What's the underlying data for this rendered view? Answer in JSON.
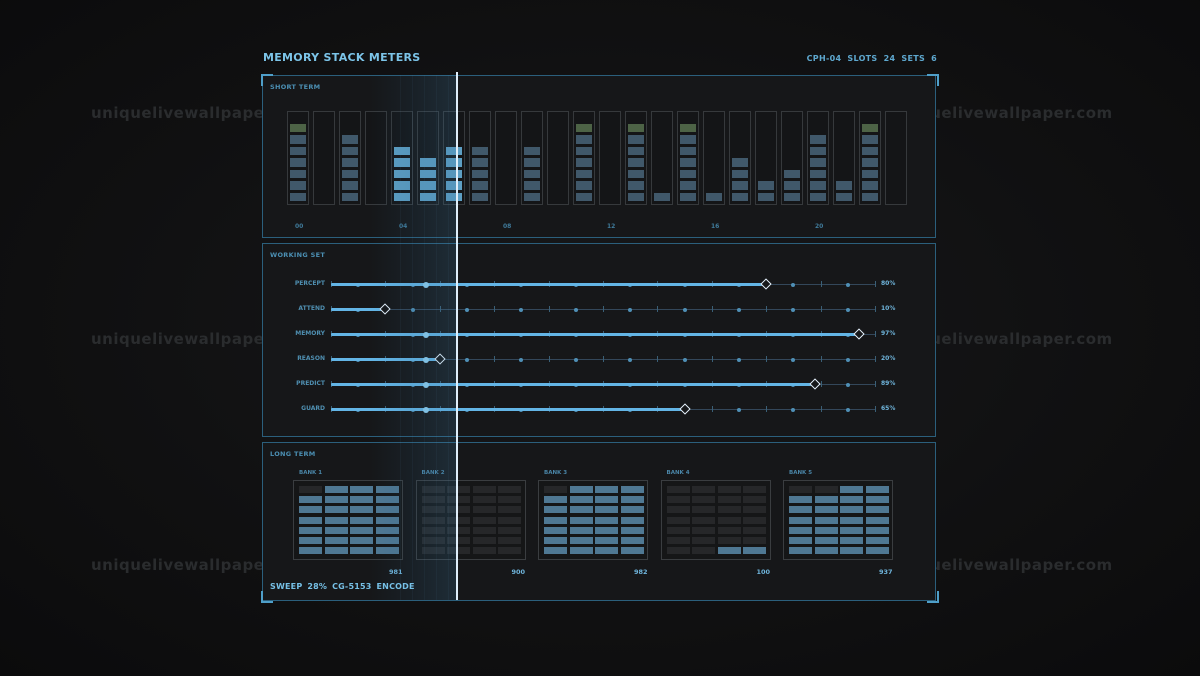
{
  "header": {
    "title": "MEMORY STACK METERS",
    "stats": "CPH-04  SLOTS 24  SETS 6"
  },
  "watermark": "uniquelivewallpaper.com",
  "short_term": {
    "label": "SHORT TERM",
    "axis_labels": [
      "00",
      "04",
      "08",
      "12",
      "16",
      "20"
    ],
    "meters": [
      {
        "level": 7,
        "warn": true,
        "active": false
      },
      {
        "level": 0,
        "warn": false,
        "active": false
      },
      {
        "level": 6,
        "warn": false,
        "active": false
      },
      {
        "level": 0,
        "warn": false,
        "active": false
      },
      {
        "level": 5,
        "warn": false,
        "active": true
      },
      {
        "level": 4,
        "warn": false,
        "active": true
      },
      {
        "level": 5,
        "warn": false,
        "active": true
      },
      {
        "level": 5,
        "warn": false,
        "active": false
      },
      {
        "level": 0,
        "warn": false,
        "active": false
      },
      {
        "level": 5,
        "warn": false,
        "active": false
      },
      {
        "level": 0,
        "warn": false,
        "active": false
      },
      {
        "level": 7,
        "warn": true,
        "active": false
      },
      {
        "level": 0,
        "warn": false,
        "active": false
      },
      {
        "level": 7,
        "warn": true,
        "active": false
      },
      {
        "level": 1,
        "warn": false,
        "active": false
      },
      {
        "level": 7,
        "warn": true,
        "active": false
      },
      {
        "level": 1,
        "warn": false,
        "active": false
      },
      {
        "level": 4,
        "warn": false,
        "active": false
      },
      {
        "level": 2,
        "warn": false,
        "active": false
      },
      {
        "level": 3,
        "warn": false,
        "active": false
      },
      {
        "level": 6,
        "warn": false,
        "active": false
      },
      {
        "level": 2,
        "warn": false,
        "active": false
      },
      {
        "level": 7,
        "warn": true,
        "active": false
      },
      {
        "level": 0,
        "warn": false,
        "active": false
      }
    ]
  },
  "working_set": {
    "label": "WORKING SET",
    "rows": [
      {
        "name": "PERCEPT",
        "value": 0.8,
        "value_label": "80%"
      },
      {
        "name": "ATTEND",
        "value": 0.1,
        "value_label": "10%"
      },
      {
        "name": "MEMORY",
        "value": 0.97,
        "value_label": "97%"
      },
      {
        "name": "REASON",
        "value": 0.2,
        "value_label": "20%"
      },
      {
        "name": "PREDICT",
        "value": 0.89,
        "value_label": "89%"
      },
      {
        "name": "GUARD",
        "value": 0.65,
        "value_label": "65%"
      }
    ]
  },
  "long_term": {
    "label": "LONG TERM",
    "banks": [
      {
        "name": "BANK 1",
        "value": "981",
        "fill": 0.95
      },
      {
        "name": "BANK 2",
        "value": "900",
        "fill": 0.0
      },
      {
        "name": "BANK 3",
        "value": "982",
        "fill": 0.95
      },
      {
        "name": "BANK 4",
        "value": "100",
        "fill": 0.08
      },
      {
        "name": "BANK 5",
        "value": "937",
        "fill": 0.92
      }
    ]
  },
  "sweep": {
    "value": 0.28
  },
  "footer": {
    "status": "SWEEP 28%  CG-5153  ENCODE"
  },
  "colors": {
    "accent": "#63b5e6",
    "border": "#2b5f7c",
    "background": "#0e0e0f",
    "warn": "#4d6346"
  }
}
